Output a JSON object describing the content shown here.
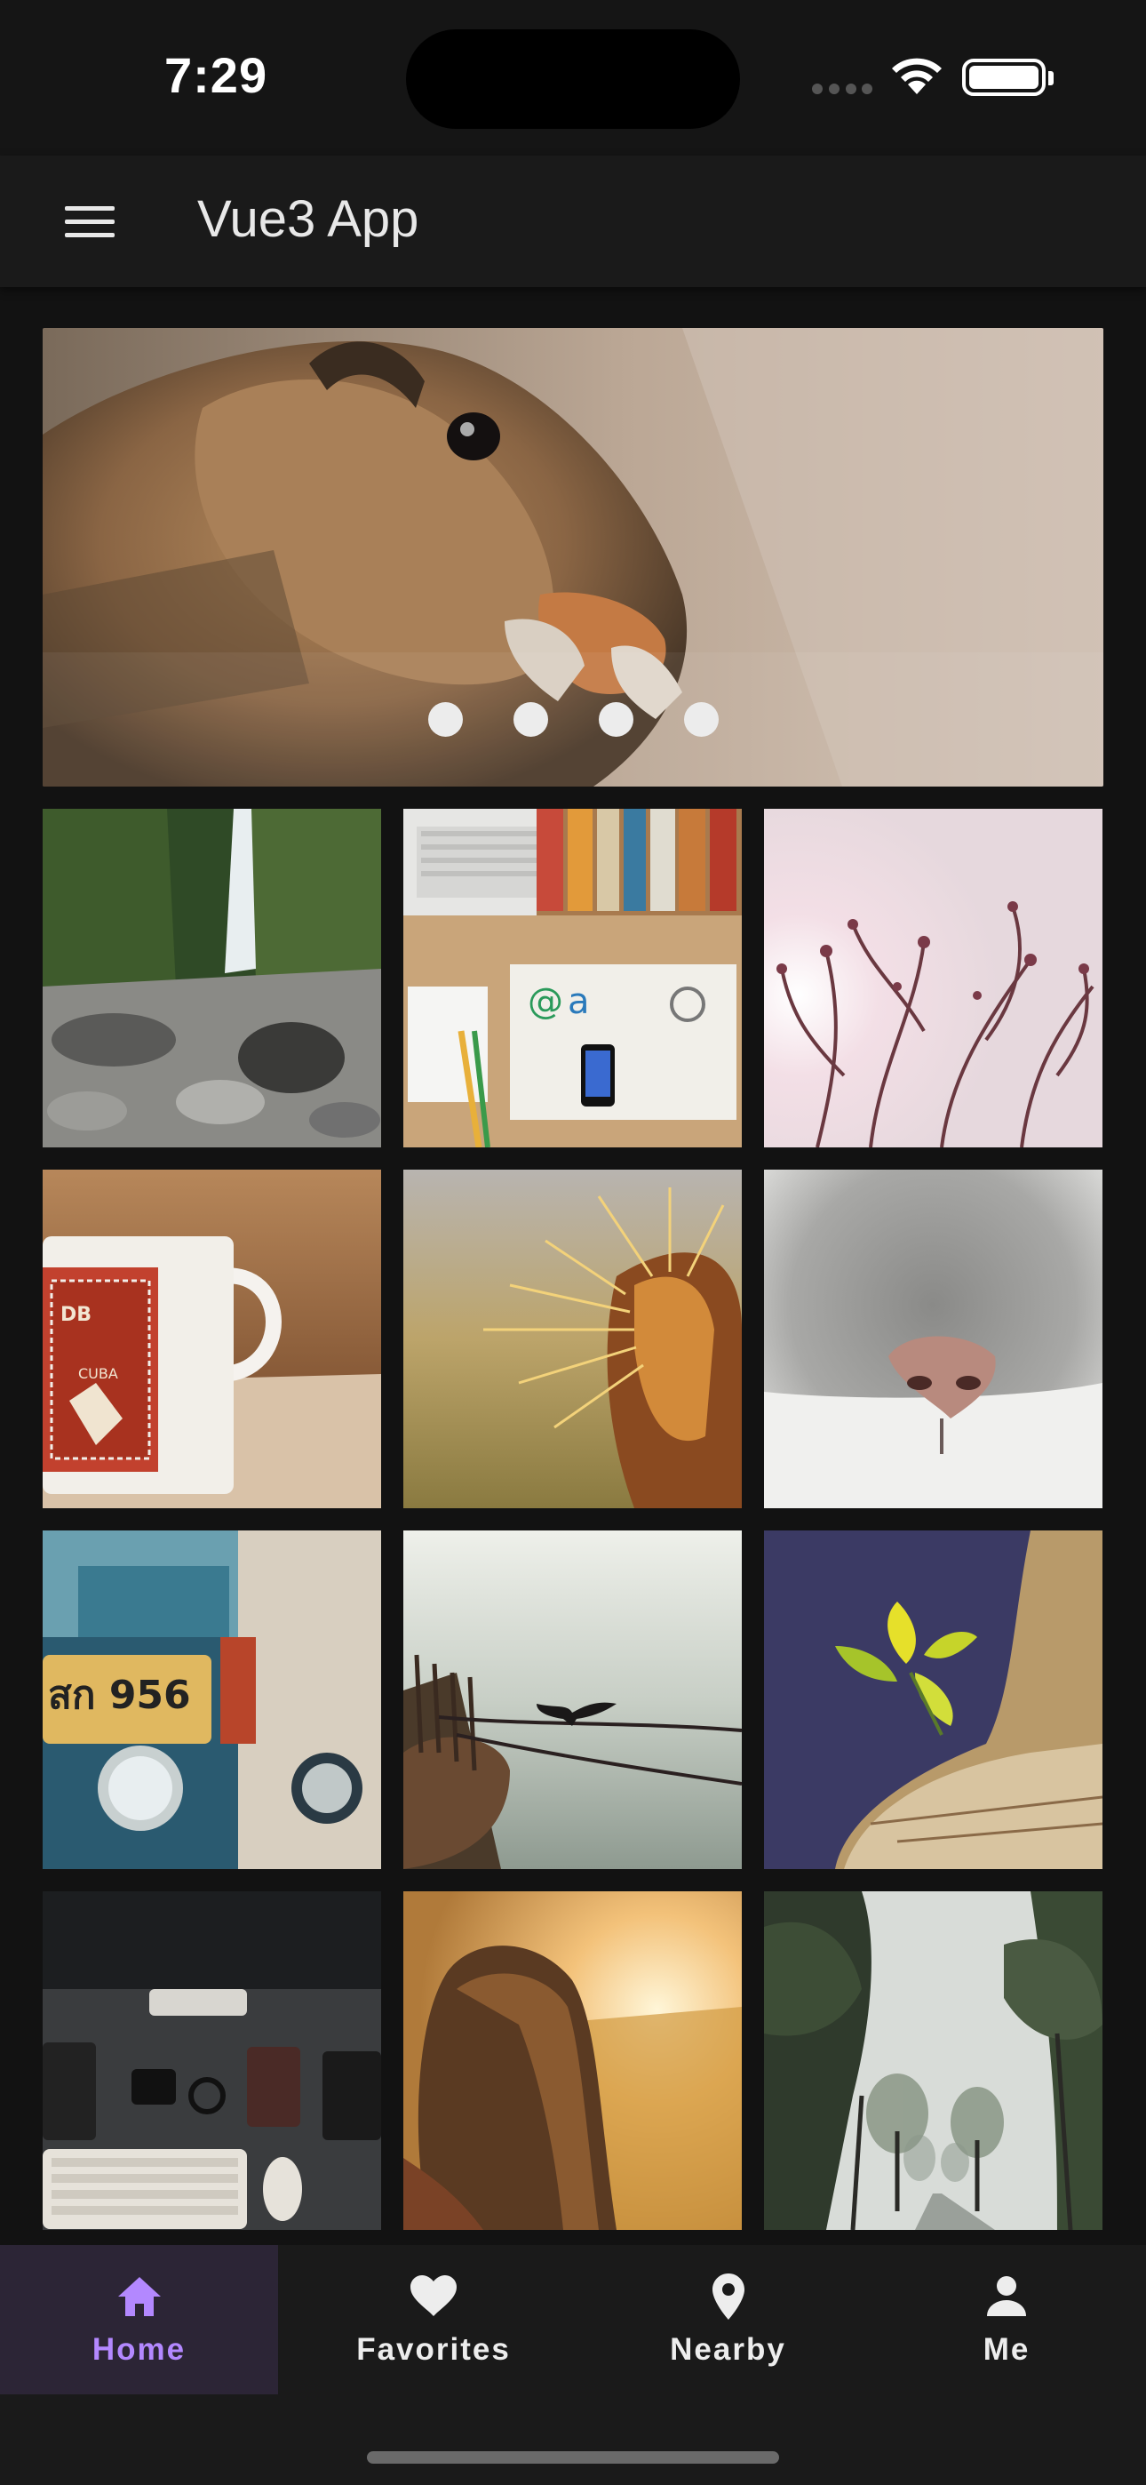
{
  "status_bar": {
    "time": "7:29"
  },
  "app_bar": {
    "title": "Vue3 App",
    "menu_icon": "hamburger-menu-icon"
  },
  "carousel": {
    "image": "chipmunk-eating-nut",
    "slide_count": 4,
    "active_index": 0
  },
  "gallery": {
    "photos": [
      "waterfall-rocks",
      "desk-laptop-books",
      "branches-pink-sky",
      "stamp-mug",
      "cactus-closeup",
      "cat-nose",
      "tuk-tuk-plate",
      "cormorant-on-rope",
      "flower-on-rock",
      "desk-keyboard-top",
      "girl-sunset-field",
      "foggy-tree-road"
    ]
  },
  "bottom_nav": {
    "items": [
      {
        "label": "Home",
        "icon": "home-icon",
        "active": true
      },
      {
        "label": "Favorites",
        "icon": "heart-icon",
        "active": false
      },
      {
        "label": "Nearby",
        "icon": "location-pin-icon",
        "active": false
      },
      {
        "label": "Me",
        "icon": "person-icon",
        "active": false
      }
    ]
  },
  "colors": {
    "background": "#121212",
    "app_bar": "#1a1a1a",
    "accent": "#b388ff",
    "active_nav_bg": "#2c2536"
  }
}
